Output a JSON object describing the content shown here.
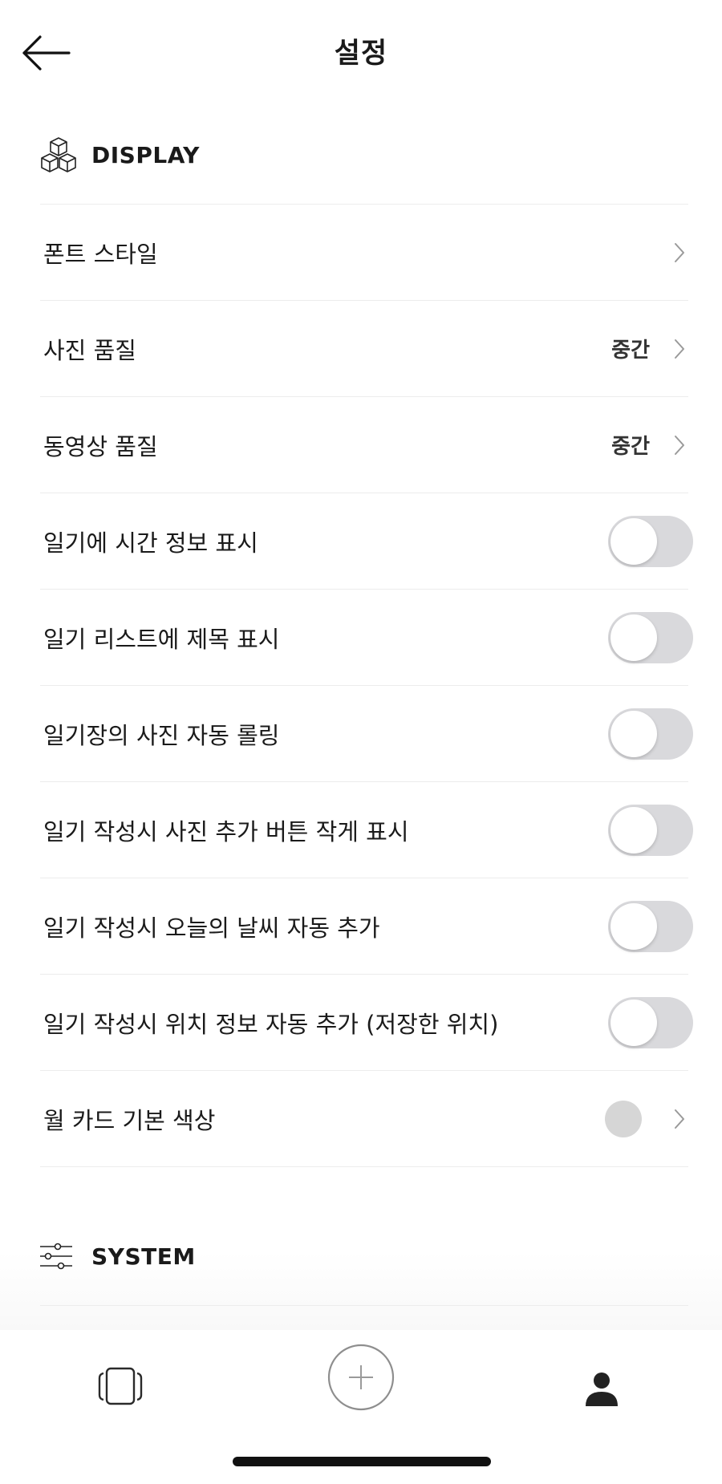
{
  "header": {
    "title": "설정",
    "back_icon": "arrow-left-icon"
  },
  "display_section": {
    "title": "DISPLAY",
    "icon": "cubes-icon",
    "rows": [
      {
        "label": "폰트 스타일",
        "type": "link"
      },
      {
        "label": "사진 품질",
        "type": "link",
        "value": "중간"
      },
      {
        "label": "동영상 품질",
        "type": "link",
        "value": "중간"
      },
      {
        "label": "일기에 시간 정보 표시",
        "type": "toggle",
        "on": false
      },
      {
        "label": "일기 리스트에 제목 표시",
        "type": "toggle",
        "on": false
      },
      {
        "label": "일기장의 사진 자동 롤링",
        "type": "toggle",
        "on": false
      },
      {
        "label": "일기 작성시 사진 추가 버튼 작게 표시",
        "type": "toggle",
        "on": false
      },
      {
        "label": "일기 작성시 오늘의 날씨 자동 추가",
        "type": "toggle",
        "on": false
      },
      {
        "label": "일기 작성시 위치 정보 자동 추가 (저장한 위치)",
        "type": "toggle",
        "on": false
      },
      {
        "label": "월 카드 기본 색상",
        "type": "color",
        "color": "#d6d6d6"
      }
    ]
  },
  "system_section": {
    "title": "SYSTEM",
    "icon": "sliders-icon"
  },
  "tabbar": {
    "tabs": [
      {
        "icon": "cards-icon"
      },
      {
        "icon": "plus-circle-icon"
      },
      {
        "icon": "person-icon",
        "active": true
      }
    ]
  },
  "colors": {
    "toggle_off": "#d9d9dc",
    "divider": "#ececec",
    "text": "#1a1a1a"
  }
}
